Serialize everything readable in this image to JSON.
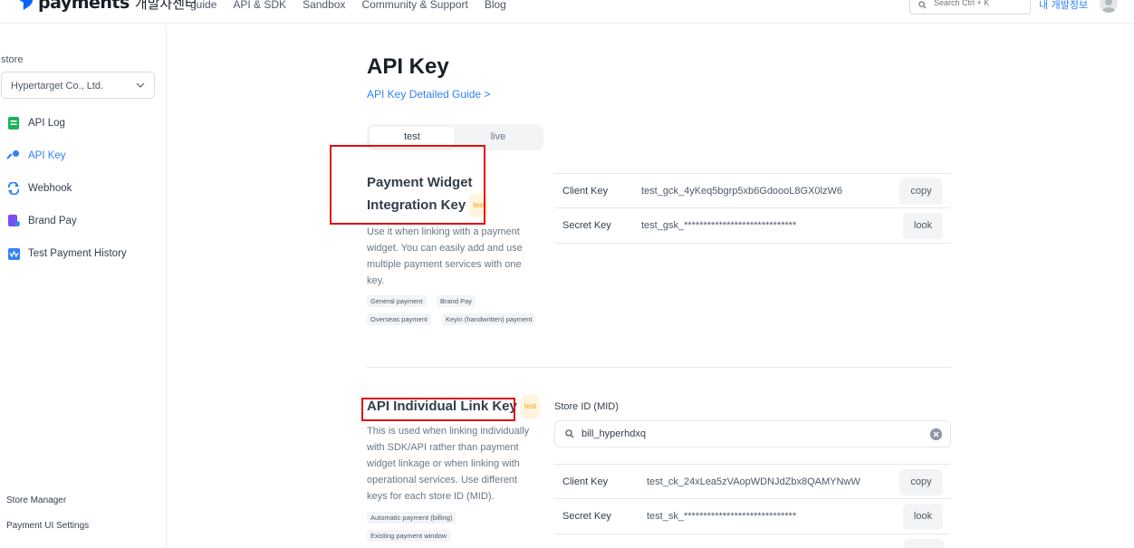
{
  "header": {
    "brand_name": "payments",
    "brand_sub": "개발자센터",
    "nav": [
      "guide",
      "API & SDK",
      "Sandbox",
      "Community & Support",
      "Blog"
    ],
    "search_placeholder": "Search Ctrl + K",
    "my_dev_info": "내 개발정보"
  },
  "sidebar": {
    "store_label": "store",
    "store_value": "Hypertarget Co., Ltd.",
    "items": [
      {
        "label": "API Log",
        "icon": "document-icon",
        "color": "#1bb25d"
      },
      {
        "label": "API Key",
        "icon": "key-icon",
        "color": "#3182f6"
      },
      {
        "label": "Webhook",
        "icon": "refresh-icon",
        "color": "#3182f6"
      },
      {
        "label": "Brand Pay",
        "icon": "card-icon",
        "color": "#7b4cf2"
      },
      {
        "label": "Test Payment History",
        "icon": "chart-icon",
        "color": "#3182f6"
      }
    ],
    "footer": [
      "Store Manager",
      "Payment UI Settings"
    ]
  },
  "main": {
    "title": "API Key",
    "guide_link": "API Key Detailed Guide >",
    "tabs": [
      "test",
      "live"
    ],
    "widget_section": {
      "title_line1": "Payment Widget",
      "title_line2": "Integration Key",
      "badge": "test",
      "description": "Use it when linking with a payment widget. You can easily add and use multiple payment services with one key.",
      "tags": [
        "General payment",
        "Brand Pay",
        "Overseas payment",
        "Keyin (handwritten) payment"
      ],
      "rows": [
        {
          "label": "Client Key",
          "value": "test_gck_4yKeq5bgrp5xb6GdoooL8GX0lzW6",
          "button": "copy"
        },
        {
          "label": "Secret Key",
          "value": "test_gsk_*****************************",
          "button": "look"
        }
      ]
    },
    "link_section": {
      "title": "API Individual Link Key",
      "badge": "test",
      "description": "This is used when linking individually with SDK/API rather than payment widget linkage or when linking with operational services. Use different keys for each store ID (MID).",
      "tags": [
        "Automatic payment (billing)",
        "Existing payment window"
      ],
      "mid_label": "Store ID (MID)",
      "mid_value": "bill_hyperhdxq",
      "rows": [
        {
          "label": "Client Key",
          "value": "test_ck_24xLea5zVAopWDNJdZbx8QAMYNwW",
          "button": "copy"
        },
        {
          "label": "Secret Key",
          "value": "test_sk_*****************************",
          "button": "look"
        }
      ]
    }
  }
}
